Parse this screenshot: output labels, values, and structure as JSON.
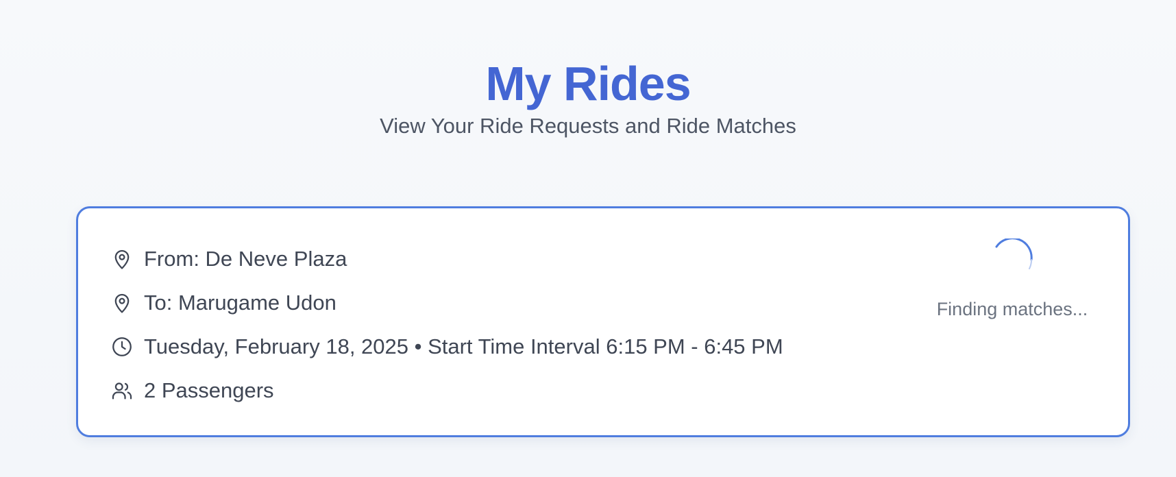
{
  "header": {
    "title": "My Rides",
    "subtitle": "View Your Ride Requests and Ride Matches"
  },
  "ride": {
    "from": "From: De Neve Plaza",
    "to": "To: Marugame Udon",
    "schedule": "Tuesday, February 18, 2025 • Start Time Interval 6:15 PM - 6:45 PM",
    "passengers": "2 Passengers",
    "status": "Finding matches..."
  },
  "icons": {
    "from": "map-pin-icon",
    "to": "map-pin-icon",
    "schedule": "clock-icon",
    "passengers": "users-icon",
    "status": "loading-spinner-icon"
  },
  "colors": {
    "accent": "#4466d3",
    "card_border": "#4f7ddf",
    "text": "#3f4654",
    "muted_text": "#6b7380"
  }
}
